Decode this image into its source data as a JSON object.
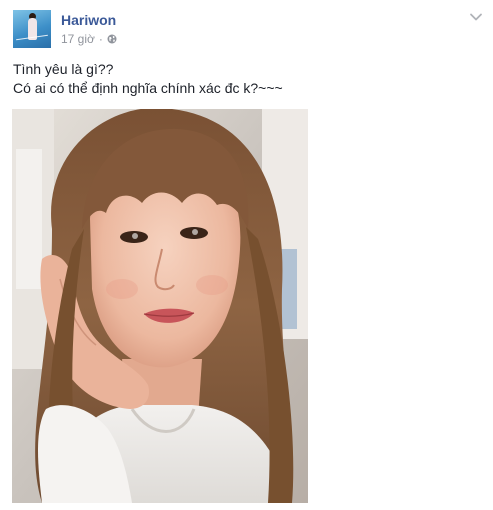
{
  "post": {
    "author": "Hariwon",
    "time": "17 giờ",
    "separator": "·",
    "privacy_icon": "globe-icon",
    "menu_icon": "chevron-down-icon",
    "text_lines": [
      "Tình yêu là gì??",
      "Có ai có thể định nghĩa chính xác đc k?~~~"
    ],
    "photo_icon": "selfie-photo"
  },
  "colors": {
    "author_link": "#3b5998",
    "meta_gray": "#90949c",
    "body_text": "#1d2129"
  }
}
